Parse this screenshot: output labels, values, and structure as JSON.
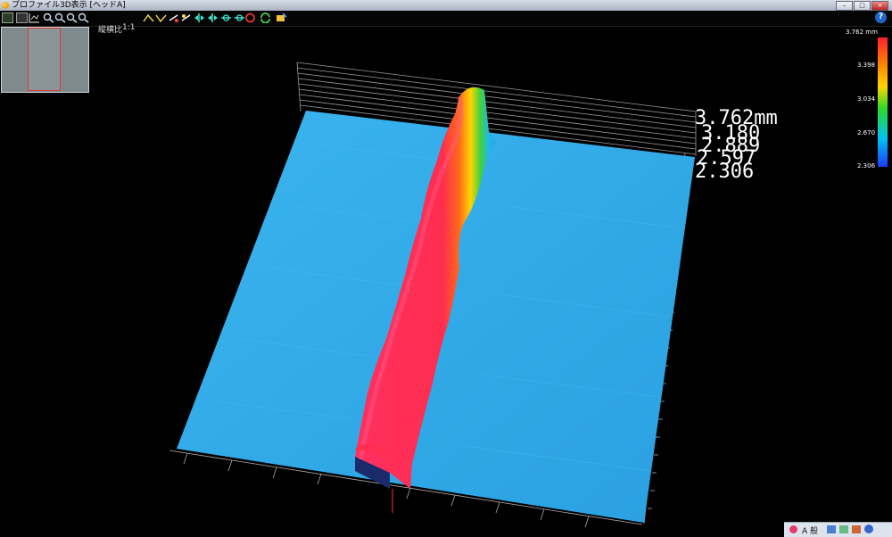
{
  "window": {
    "title": "プロファイル3D表示  [ヘッドA]",
    "controls": [
      "–",
      "□",
      "×"
    ]
  },
  "toolbar": {
    "aspect_label": "縦横比",
    "aspect_value": "1:1",
    "icons": [
      "profile-view-icon",
      "layout-icon",
      "graph-icon",
      "zoom-in-icon",
      "zoom-out-icon",
      "zoom-fit-icon",
      "zoom-reset-icon",
      "axis-x-icon",
      "axis-y-icon",
      "rotate-icon",
      "light-icon",
      "move-left-icon",
      "move-right-icon",
      "move-up-icon",
      "move-down-icon",
      "reset-view-icon",
      "refresh-icon",
      "capture-icon"
    ]
  },
  "plot": {
    "height_labels": [
      "3.762mm",
      "3.180",
      "2.889",
      "2.597",
      "2.306"
    ],
    "colors": {
      "low": "#2aa6e6",
      "high": "#ff2d4f"
    }
  },
  "colorbar": {
    "unit": "mm",
    "labels": [
      "3.762 mm",
      "3.398",
      "3.034",
      "2.670",
      "2.306"
    ],
    "colors": [
      "#ff1f2d",
      "#ff8a00",
      "#ffd500",
      "#2bd92b",
      "#00c4f2",
      "#1c3cff"
    ]
  },
  "taskbar": {
    "ime": "A 般"
  }
}
